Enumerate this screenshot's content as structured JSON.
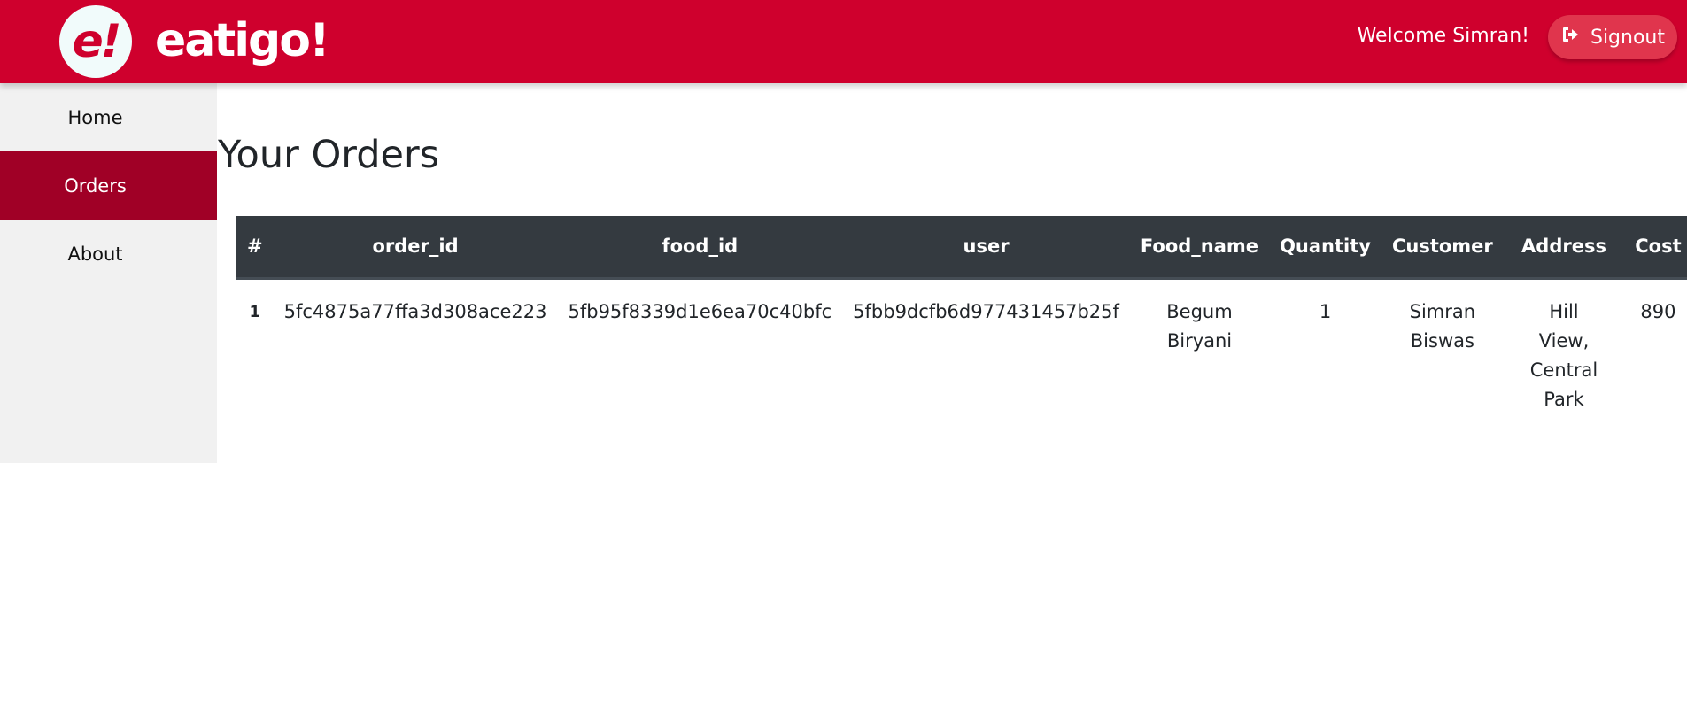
{
  "header": {
    "logo_text": "e!",
    "brand": "eatigo!",
    "welcome": "Welcome Simran!",
    "signout_label": "Signout",
    "colors": {
      "primary": "#cf002d",
      "active_nav": "#a00026",
      "table_header": "#343a40"
    }
  },
  "sidebar": {
    "items": [
      {
        "label": "Home",
        "active": false
      },
      {
        "label": "Orders",
        "active": true
      },
      {
        "label": "About",
        "active": false
      }
    ]
  },
  "main": {
    "title": "Your Orders",
    "table": {
      "columns": [
        "#",
        "order_id",
        "food_id",
        "user",
        "Food_name",
        "Quantity",
        "Customer",
        "Address",
        "Cost"
      ],
      "rows": [
        {
          "index": "1",
          "order_id": "5fc4875a77ffa3d308ace223",
          "food_id": "5fb95f8339d1e6ea70c40bfc",
          "user": "5fbb9dcfb6d977431457b25f",
          "food_name": "Begum Biryani",
          "quantity": "1",
          "customer": "Simran Biswas",
          "address": "Hill View, Central Park",
          "cost": "890"
        }
      ]
    }
  }
}
